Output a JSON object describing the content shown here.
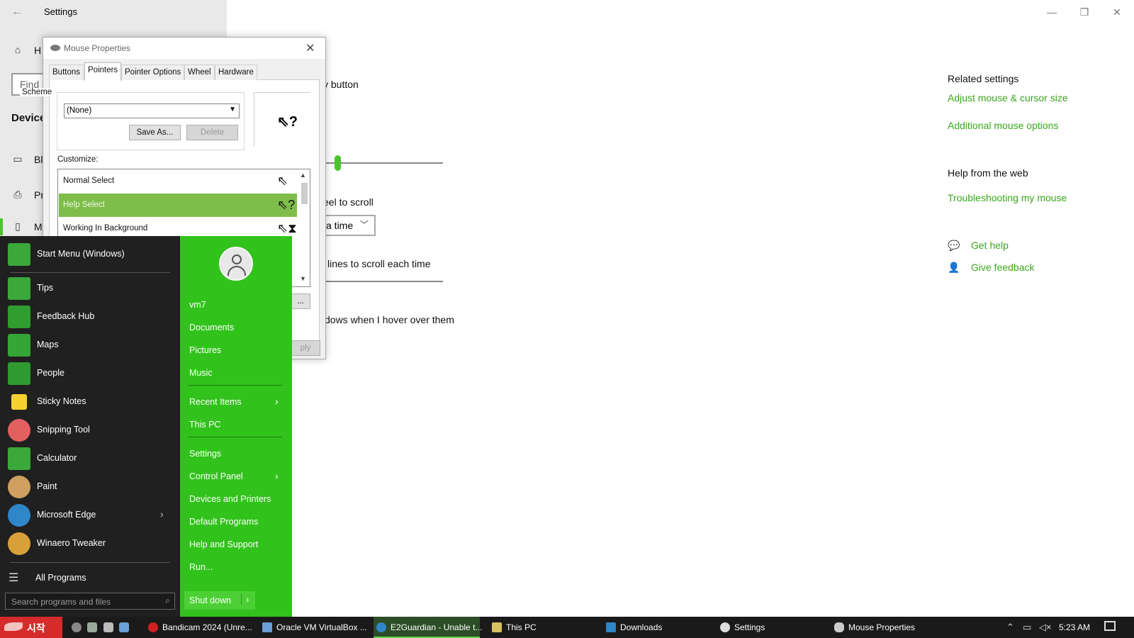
{
  "settings": {
    "title": "Settings",
    "nav": {
      "home_label": "H",
      "find_placeholder": "Find a",
      "section": "Device",
      "items": [
        {
          "label": "Bl",
          "icon": "bluetooth-icon"
        },
        {
          "label": "Pr",
          "icon": "printer-icon"
        },
        {
          "label": "M",
          "icon": "mouse-icon"
        }
      ]
    },
    "content": {
      "primary_button_text": "y button",
      "wheel_text": "eel to scroll",
      "scroll_dropdown_value": "a time",
      "lines_text": "lines to scroll each time",
      "hover_text": "dows when I hover over them"
    },
    "related": {
      "heading": "Related settings",
      "links": [
        "Adjust mouse & cursor size",
        "Additional mouse options"
      ],
      "help_heading": "Help from the web",
      "help_link": "Troubleshooting my mouse",
      "get_help": "Get help",
      "give_feedback": "Give feedback"
    }
  },
  "dialog": {
    "title": "Mouse Properties",
    "tabs": [
      "Buttons",
      "Pointers",
      "Pointer Options",
      "Wheel",
      "Hardware"
    ],
    "active_tab": "Pointers",
    "scheme_label": "Scheme",
    "scheme_value": "(None)",
    "save_as": "Save As...",
    "delete": "Delete",
    "customize_label": "Customize:",
    "cursors": [
      {
        "label": "Normal Select",
        "selected": false
      },
      {
        "label": "Help Select",
        "selected": true
      },
      {
        "label": "Working In Background",
        "selected": false
      }
    ],
    "apply_partial": "ply",
    "browse_partial": "..."
  },
  "start_menu": {
    "header": "Start Menu (Windows)",
    "apps": [
      {
        "label": "Tips",
        "color": "#3aa83a"
      },
      {
        "label": "Feedback Hub",
        "color": "#2f9d2f"
      },
      {
        "label": "Maps",
        "color": "#35a535"
      },
      {
        "label": "People",
        "color": "#2f9a2f"
      },
      {
        "label": "Sticky Notes",
        "color": "#f5d130"
      },
      {
        "label": "Snipping Tool",
        "color": "#e36060"
      },
      {
        "label": "Calculator",
        "color": "#3aa83a"
      },
      {
        "label": "Paint",
        "color": "#d0a060"
      },
      {
        "label": "Microsoft Edge",
        "color": "#2f86c9"
      },
      {
        "label": "Winaero Tweaker",
        "color": "#d8a038"
      }
    ],
    "all_programs": "All Programs",
    "search_placeholder": "Search programs and files",
    "user": "vm7",
    "right": [
      "Documents",
      "Pictures",
      "Music",
      "Recent Items",
      "This PC",
      "Settings",
      "Control Panel",
      "Devices and Printers",
      "Default Programs",
      "Help and Support",
      "Run..."
    ],
    "shutdown": "Shut down"
  },
  "taskbar": {
    "start_label": "시작",
    "items": [
      {
        "label": "Bandicam 2024 (Unre...",
        "color": "#d02020"
      },
      {
        "label": "Oracle VM VirtualBox ...",
        "color": "#6aa0d8"
      },
      {
        "label": "E2Guardian - Unable t...",
        "color": "#2f86c9"
      },
      {
        "label": "This PC",
        "color": "#d8c060"
      },
      {
        "label": "Downloads",
        "color": "#2f86c9"
      },
      {
        "label": "Settings",
        "color": "#dddddd"
      },
      {
        "label": "Mouse Properties",
        "color": "#cccccc"
      }
    ],
    "clock": "5:23 AM"
  }
}
